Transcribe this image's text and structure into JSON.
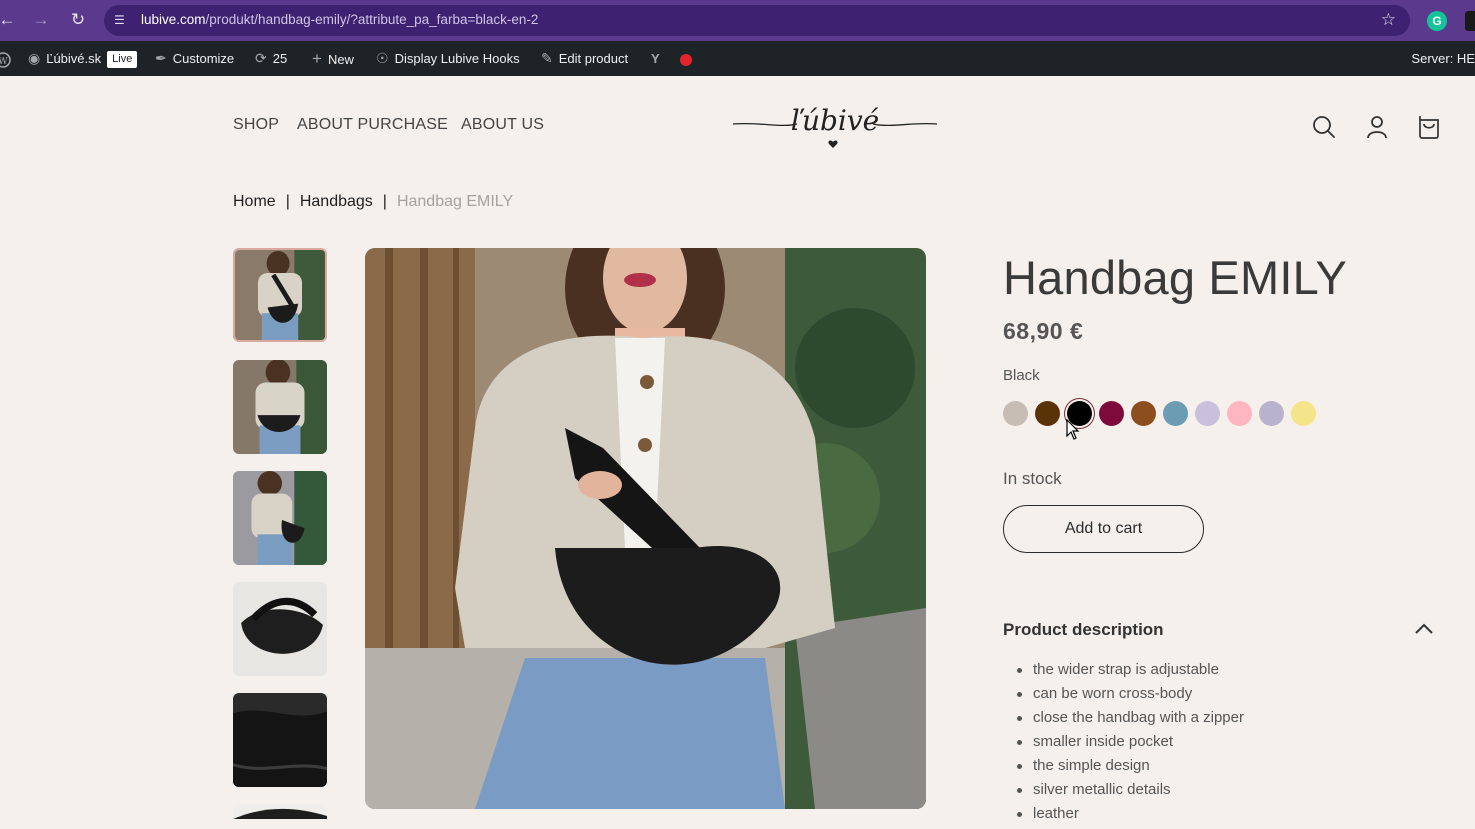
{
  "browser": {
    "back_icon": "back-arrow-icon",
    "forward_icon": "forward-arrow-icon",
    "reload_icon": "reload-icon",
    "url_host": "lubive.com",
    "url_path": "/produkt/handbag-emily/?attribute_pa_farba=black-en-2",
    "bookmark_icon": "star-icon",
    "extension_label": "G"
  },
  "admin_bar": {
    "site_name": "Ľúbivé.sk",
    "live_badge": "Live",
    "customize": "Customize",
    "updates_count": "25",
    "new": "New",
    "display_hooks": "Display Lubive Hooks",
    "edit_product": "Edit product",
    "server": "Server: HE"
  },
  "nav": {
    "items": [
      "SHOP",
      "ABOUT PURCHASE",
      "ABOUT US"
    ],
    "logo_text": "ľúbivé",
    "icons": [
      "search-icon",
      "account-icon",
      "cart-icon"
    ]
  },
  "breadcrumb": {
    "home": "Home",
    "category": "Handbags",
    "current": "Handbag EMILY"
  },
  "product": {
    "title": "Handbag EMILY",
    "price": "68,90 €",
    "selected_color": "Black",
    "colors": [
      {
        "name": "beige",
        "hex": "#c8bdb5"
      },
      {
        "name": "dark-brown",
        "hex": "#5a3208"
      },
      {
        "name": "black",
        "hex": "#000000",
        "selected": true
      },
      {
        "name": "burgundy",
        "hex": "#7d0a3a"
      },
      {
        "name": "cognac",
        "hex": "#8c4e1e"
      },
      {
        "name": "blue",
        "hex": "#6b9cb4"
      },
      {
        "name": "lavender",
        "hex": "#c9c0dc"
      },
      {
        "name": "pink",
        "hex": "#ffb6c1"
      },
      {
        "name": "lilac",
        "hex": "#b9b2cc"
      },
      {
        "name": "yellow",
        "hex": "#f4e48a"
      }
    ],
    "stock": "In stock",
    "add_to_cart": "Add to cart",
    "description_title": "Product description",
    "description_items": [
      "the wider strap is adjustable",
      "can be worn cross-body",
      "close the handbag with a zipper",
      "smaller inside pocket",
      "the simple design",
      "silver metallic details",
      "leather"
    ]
  }
}
